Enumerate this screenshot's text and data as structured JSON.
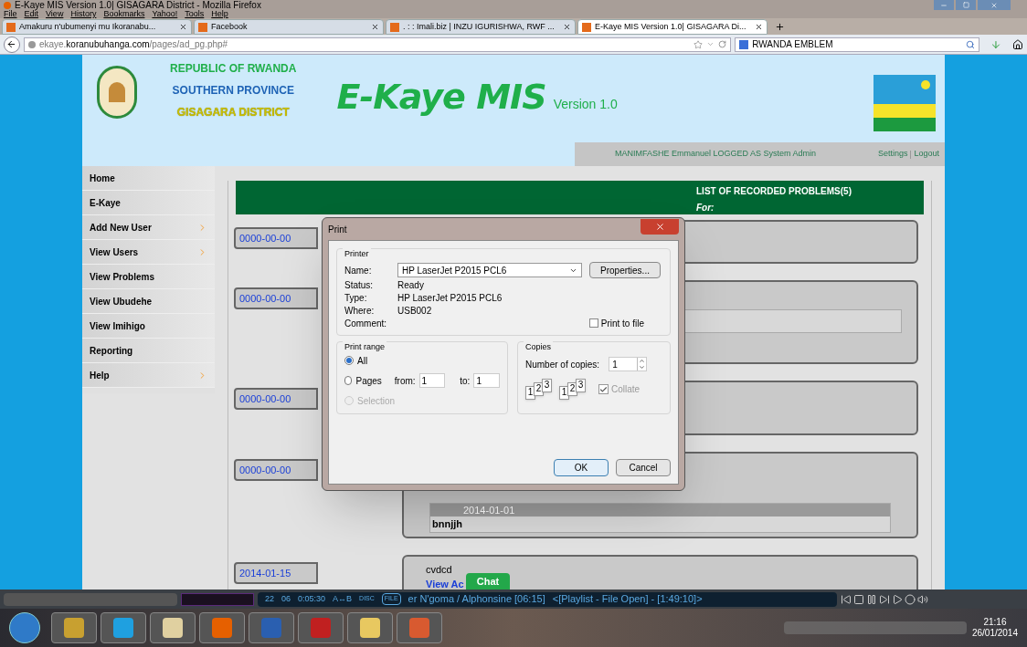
{
  "browser": {
    "title": "E-Kaye MIS Version 1.0| GISAGARA District - Mozilla Firefox",
    "menu": [
      "File",
      "Edit",
      "View",
      "History",
      "Bookmarks",
      "Yahoo!",
      "Tools",
      "Help"
    ],
    "tabs": [
      {
        "label": "Amakuru n'ubumenyi mu Ikoranabu...",
        "selected": false
      },
      {
        "label": "Facebook",
        "selected": false
      },
      {
        "label": ". : : Imali.biz | INZU IGURISHWA, RWF ...",
        "selected": false
      },
      {
        "label": "E-Kaye MIS Version 1.0| GISAGARA Di...",
        "selected": true
      }
    ],
    "url_sub": "ekaye.",
    "url_host": "koranubuhanga.com",
    "url_path": "/pages/ad_pg.php#",
    "search": "RWANDA EMBLEM"
  },
  "header": {
    "country": "REPUBLIC OF RWANDA",
    "province": "SOUTHERN PROVINCE",
    "district": "GISAGARA DISTRICT",
    "app_title": "E-Kaye MIS",
    "version": "Version 1.0",
    "user_line": "MANIMFASHE Emmanuel  LOGGED AS System Admin",
    "links": [
      "Settings",
      "Logout"
    ]
  },
  "sidebar": [
    {
      "label": "Home",
      "submenu": false
    },
    {
      "label": "E-Kaye",
      "submenu": false
    },
    {
      "label": "Add New User",
      "submenu": true
    },
    {
      "label": "View Users",
      "submenu": true
    },
    {
      "label": "View Problems",
      "submenu": false
    },
    {
      "label": "View Ubudehe",
      "submenu": false
    },
    {
      "label": "View Imihigo",
      "submenu": false
    },
    {
      "label": "Reporting",
      "submenu": false
    },
    {
      "label": "Help",
      "submenu": true
    }
  ],
  "list": {
    "title": "LIST OF RECORDED PROBLEMS(5)",
    "subtitle": "For:"
  },
  "entries": [
    {
      "date": "0000-00-00"
    },
    {
      "date": "0000-00-00",
      "items": [
        {
          "kind": "bar"
        }
      ]
    },
    {
      "date": "0000-00-00"
    },
    {
      "date": "0000-00-00",
      "items": [
        {
          "kind": "table",
          "header": "2014-01-01",
          "cell": "bnnjjh"
        }
      ]
    },
    {
      "date": "2014-01-15",
      "items": [
        {
          "kind": "text",
          "text": "cvdcd"
        },
        {
          "kind": "link",
          "text": "View Ac"
        }
      ]
    }
  ],
  "chat": "Chat",
  "dialog": {
    "title": "Print",
    "printer_group": "Printer",
    "name_label": "Name:",
    "name_value": "HP LaserJet P2015 PCL6",
    "properties": "Properties...",
    "info": [
      {
        "label": "Status:",
        "value": "Ready"
      },
      {
        "label": "Type:",
        "value": "HP LaserJet P2015 PCL6"
      },
      {
        "label": "Where:",
        "value": "USB002"
      },
      {
        "label": "Comment:"
      }
    ],
    "print_to_file": {
      "label": "Print to file",
      "checked": false
    },
    "range_group": "Print range",
    "range": [
      {
        "label": "All",
        "selected": true,
        "disabled": false
      },
      {
        "label": "Pages",
        "selected": false,
        "disabled": false
      },
      {
        "label": "Selection",
        "selected": false,
        "disabled": true
      }
    ],
    "from_label": "from:",
    "from_value": "1",
    "to_label": "to:",
    "to_value": "1",
    "copies_group": "Copies",
    "copies_label": "Number of copies:",
    "copies_value": "1",
    "collate": {
      "label": "Collate",
      "checked": true
    },
    "collate_pages": [
      [
        "1",
        "2",
        "3"
      ],
      [
        "1",
        "2",
        "3"
      ]
    ],
    "buttons": [
      {
        "label": "OK",
        "default": true
      },
      {
        "label": "Cancel",
        "default": false
      }
    ]
  },
  "media": {
    "track": "22",
    "chapter": "06",
    "time": "0:05:30",
    "ab": "A↔B",
    "disc": "DISC",
    "file": "FILE",
    "title": "er N'goma / Alphonsine  [06:15]",
    "playlist": "<[Playlist - File Open] - [1:49:10]>"
  },
  "taskbar": {
    "time": "21:16",
    "date": "26/01/2014"
  }
}
